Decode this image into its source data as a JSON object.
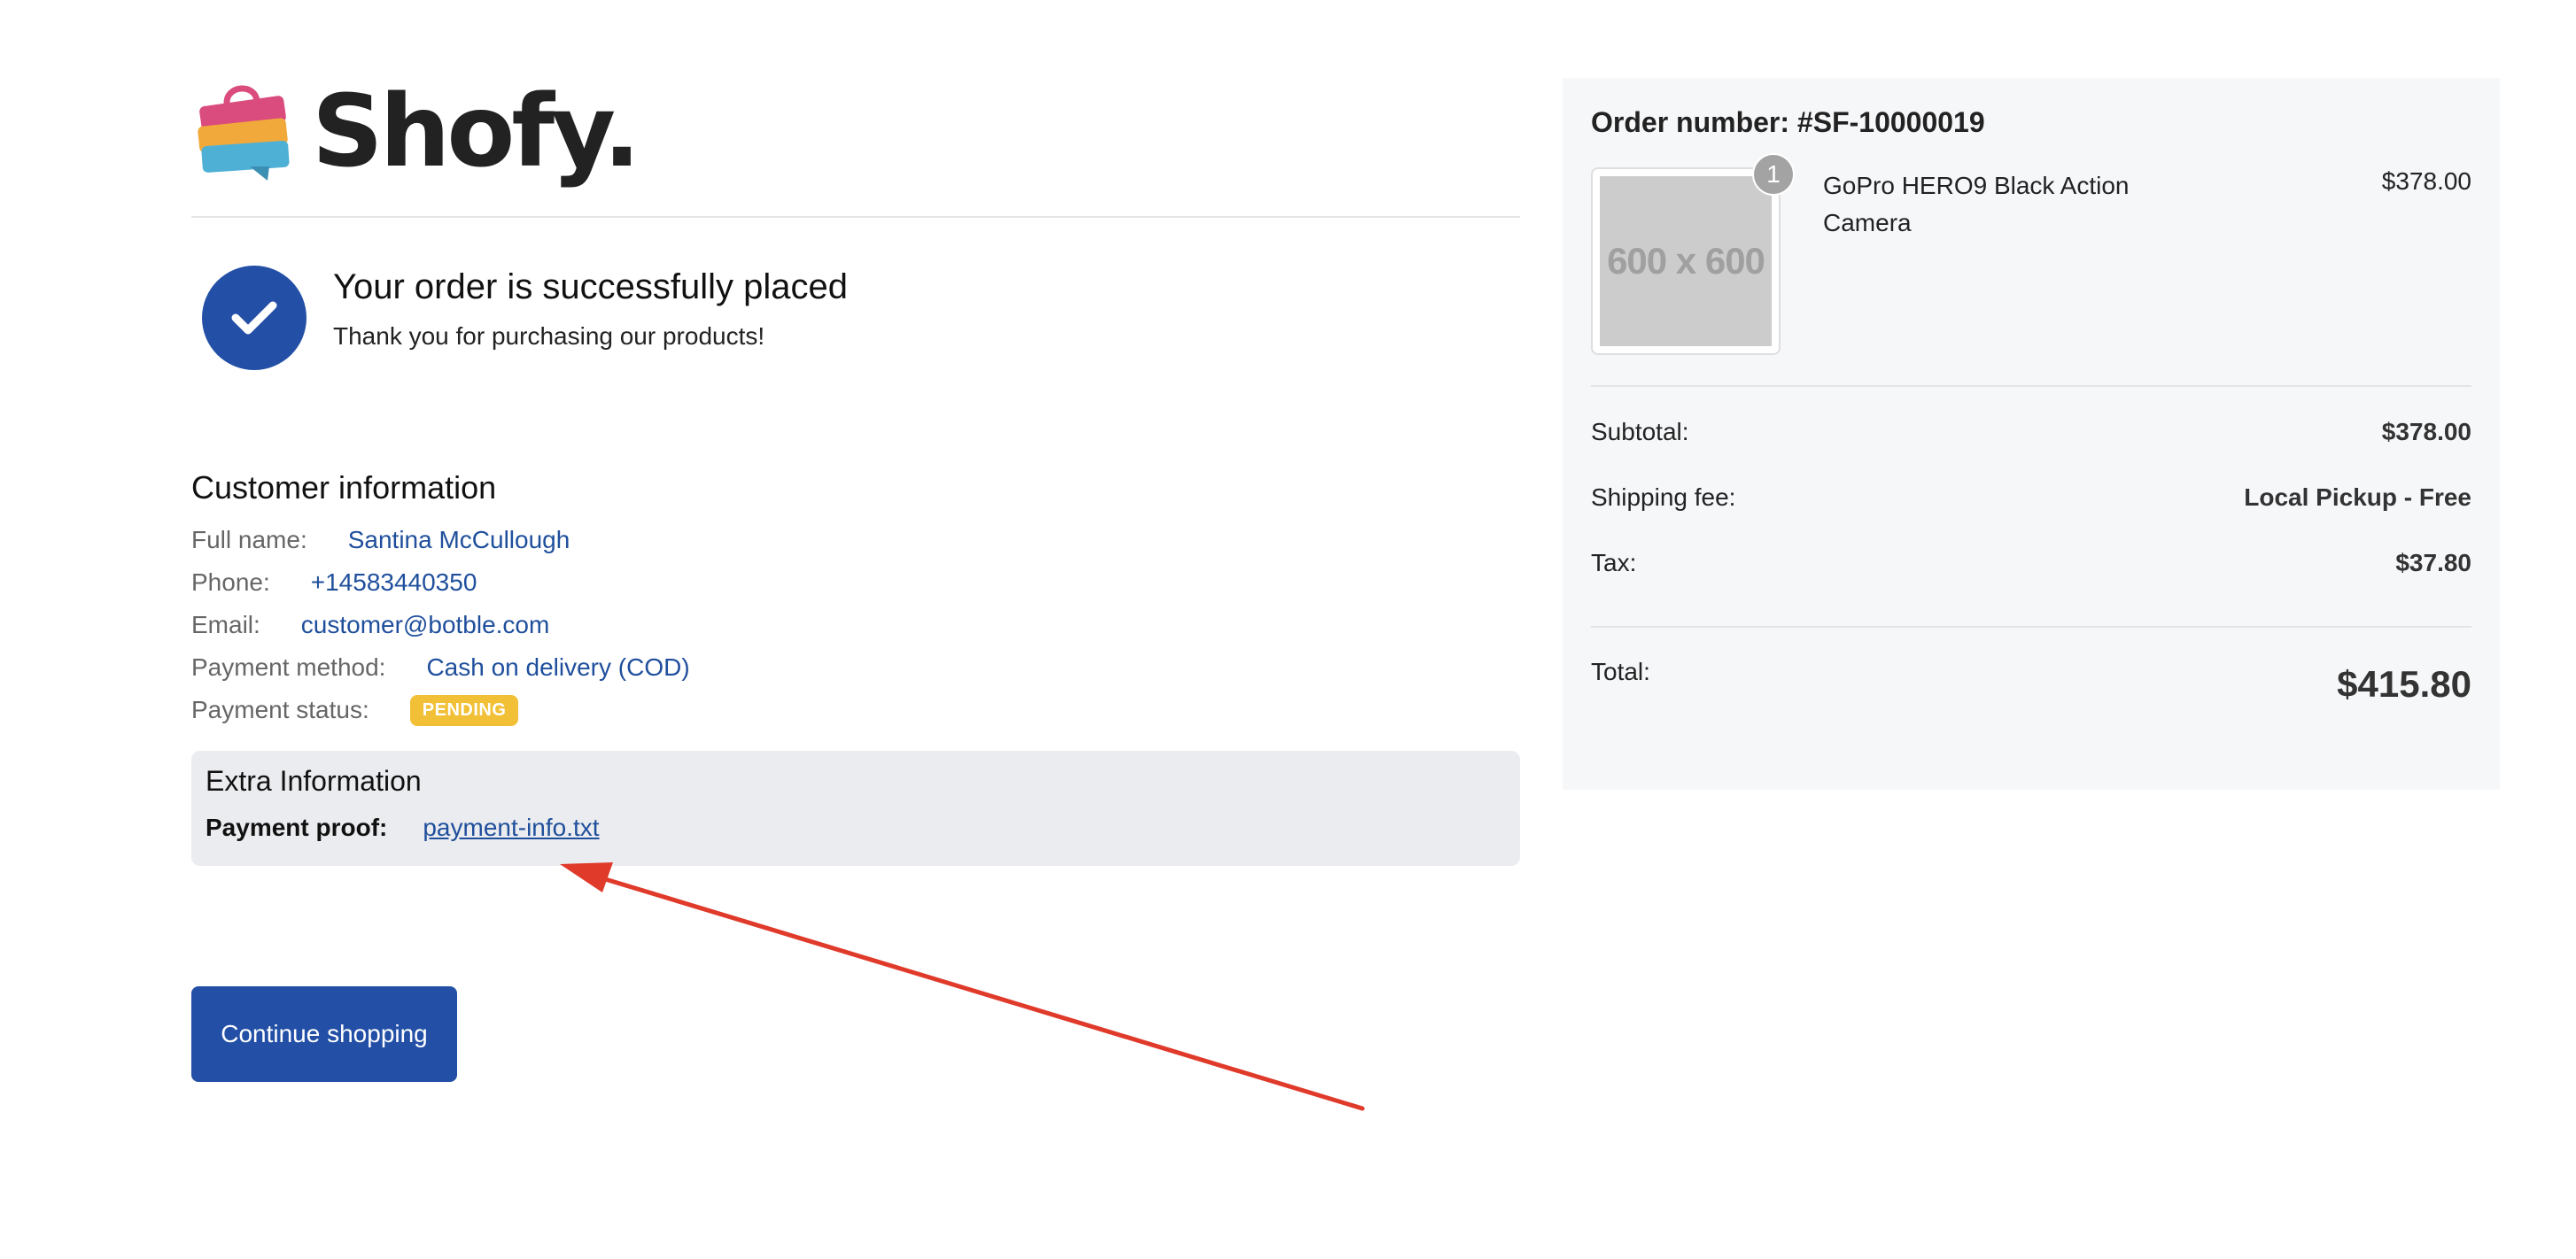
{
  "brand": {
    "name": "Shofy."
  },
  "success": {
    "title": "Your order is successfully placed",
    "subtitle": "Thank you for purchasing our products!"
  },
  "customer": {
    "title": "Customer information",
    "full_name_label": "Full name:",
    "full_name": "Santina McCullough",
    "phone_label": "Phone:",
    "phone": "+14583440350",
    "email_label": "Email:",
    "email": "customer@botble.com",
    "payment_method_label": "Payment method:",
    "payment_method": "Cash on delivery (COD)",
    "payment_status_label": "Payment status:",
    "payment_status": "PENDING"
  },
  "extra": {
    "title": "Extra Information",
    "proof_label": "Payment proof:",
    "proof_file": "payment-info.txt"
  },
  "actions": {
    "continue_label": "Continue shopping"
  },
  "order": {
    "number_label": "Order number: #SF-10000019",
    "item": {
      "name": "GoPro HERO9 Black Action Camera",
      "price": "$378.00",
      "quantity": "1",
      "thumb_text": "600 x 600"
    },
    "subtotal_label": "Subtotal:",
    "subtotal": "$378.00",
    "shipping_label": "Shipping fee:",
    "shipping": "Local Pickup - Free",
    "tax_label": "Tax:",
    "tax": "$37.80",
    "total_label": "Total:",
    "total": "$415.80"
  },
  "colors": {
    "primary": "#2350a6",
    "link": "#1f4f9c",
    "badge": "#f2c036",
    "annotation_arrow": "#e03a2b"
  }
}
